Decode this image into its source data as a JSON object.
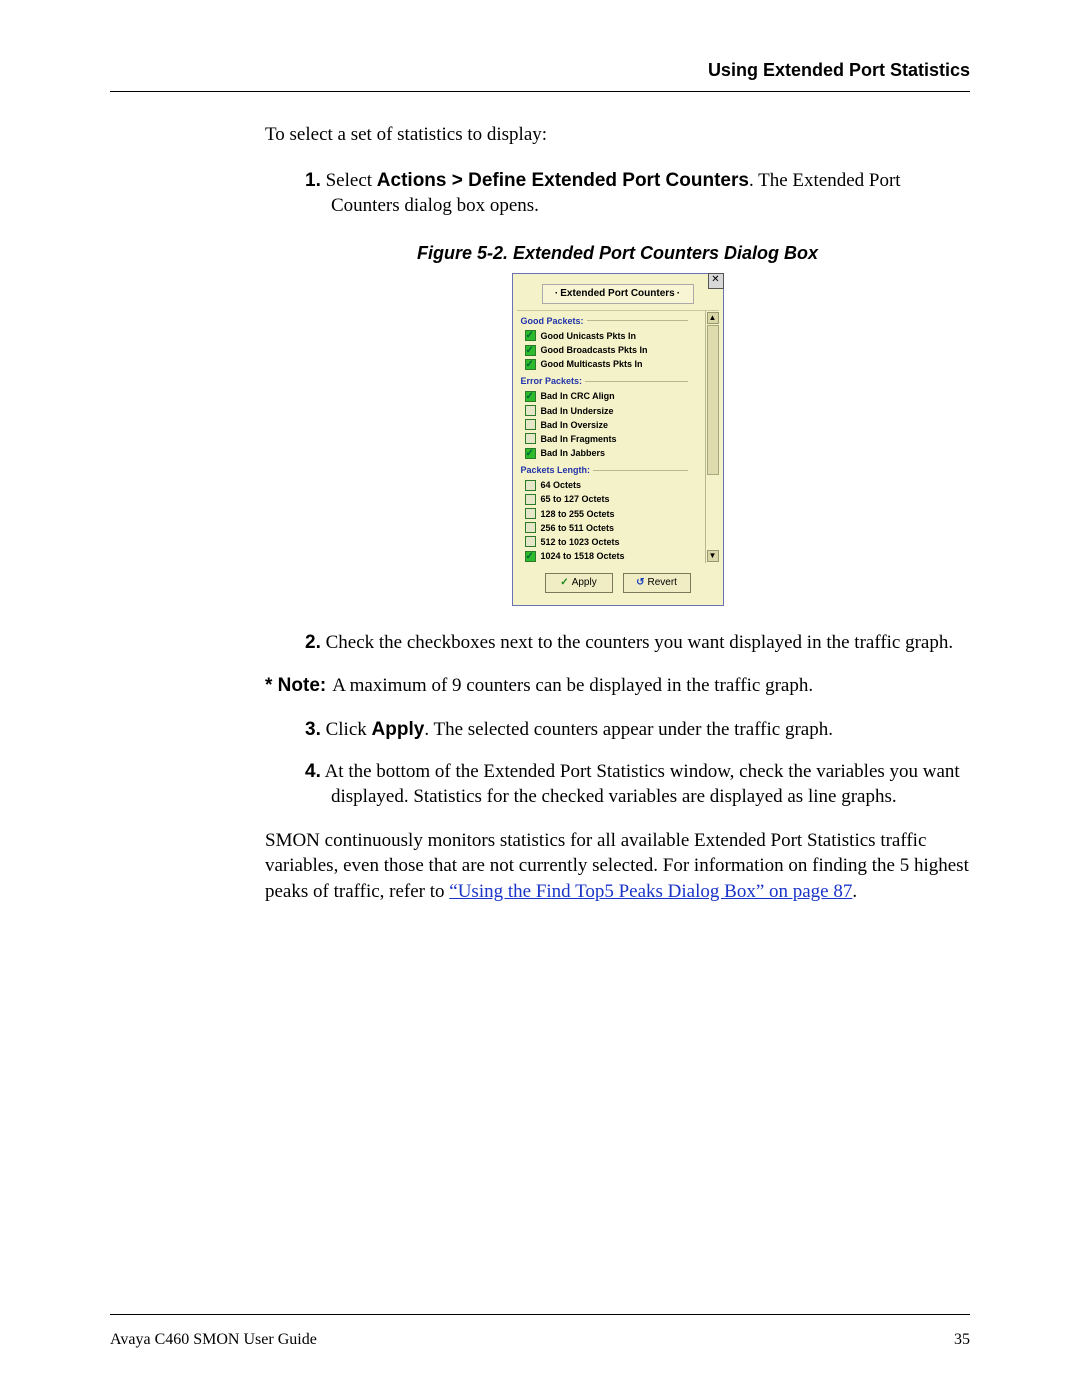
{
  "header": {
    "section_title": "Using Extended Port Statistics"
  },
  "intro": "To select a set of statistics to display:",
  "steps": {
    "s1": {
      "num": "1.",
      "pre": "Select ",
      "bold": "Actions > Define Extended Port Counters",
      "post": ". The Extended Port Counters dialog box opens."
    },
    "s2": {
      "num": "2.",
      "text": "Check the checkboxes next to the counters you want displayed in the traffic graph."
    },
    "s3": {
      "num": "3.",
      "pre": "Click ",
      "bold": "Apply",
      "post": ". The selected counters appear under the traffic graph."
    },
    "s4": {
      "num": "4.",
      "text": "At the bottom of the Extended Port Statistics window, check the variables you want displayed. Statistics for the checked variables are displayed as line graphs."
    }
  },
  "figure": {
    "caption": "Figure 5-2.  Extended Port Counters Dialog Box"
  },
  "dialog": {
    "title": "Extended Port Counters",
    "groups": [
      {
        "label": "Good Packets:",
        "items": [
          {
            "label": "Good Unicasts Pkts In",
            "checked": true
          },
          {
            "label": "Good Broadcasts Pkts In",
            "checked": true
          },
          {
            "label": "Good Multicasts Pkts In",
            "checked": true
          }
        ]
      },
      {
        "label": "Error Packets:",
        "items": [
          {
            "label": "Bad In CRC Align",
            "checked": true
          },
          {
            "label": "Bad In Undersize",
            "checked": false
          },
          {
            "label": "Bad In Oversize",
            "checked": false
          },
          {
            "label": "Bad In Fragments",
            "checked": false
          },
          {
            "label": "Bad In Jabbers",
            "checked": true
          }
        ]
      },
      {
        "label": "Packets Length:",
        "items": [
          {
            "label": "64 Octets",
            "checked": false
          },
          {
            "label": "65 to 127 Octets",
            "checked": false
          },
          {
            "label": "128 to 255 Octets",
            "checked": false
          },
          {
            "label": "256 to 511 Octets",
            "checked": false
          },
          {
            "label": "512 to 1023 Octets",
            "checked": false
          },
          {
            "label": "1024 to 1518 Octets",
            "checked": true
          }
        ]
      }
    ],
    "apply_label": "Apply",
    "revert_label": "Revert"
  },
  "note": {
    "prefix": "* Note:",
    "text": "A maximum of 9 counters can be displayed in the traffic graph."
  },
  "closing": {
    "pre": "SMON continuously monitors statistics for all available Extended Port Statistics traffic variables, even those that are not currently selected. For information on finding the 5 highest peaks of traffic, refer to ",
    "link": "“Using the Find Top5 Peaks Dialog Box” on page 87",
    "post": "."
  },
  "footer": {
    "left": "Avaya C460 SMON User Guide",
    "right": "35"
  }
}
